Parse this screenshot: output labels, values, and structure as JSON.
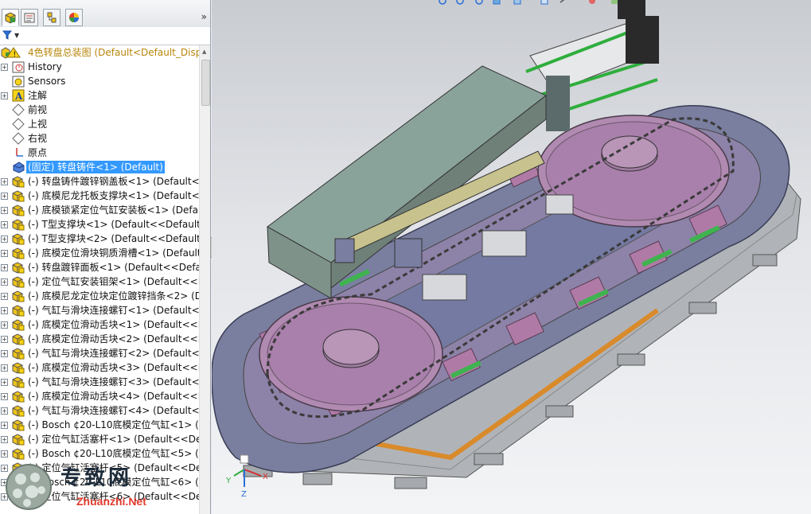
{
  "colors": {
    "selection": "#3399ff",
    "root_label": "#b8860b"
  },
  "panel": {
    "tabs": [
      "feature-manager",
      "property-manager",
      "configuration-manager",
      "appearance-manager"
    ],
    "expand_glyph": "»",
    "filter_icon": "funnel-icon"
  },
  "tree": {
    "root": "4色转盘总装图 (Default<Default_Disp",
    "items": [
      {
        "label": "History",
        "icon": "history-icon",
        "expand": true
      },
      {
        "label": "Sensors",
        "icon": "sensors-icon",
        "expand": false
      },
      {
        "label": "注解",
        "icon": "annotations-icon",
        "expand": true
      },
      {
        "label": "前视",
        "icon": "plane-icon",
        "expand": false
      },
      {
        "label": "上视",
        "icon": "plane-icon",
        "expand": false
      },
      {
        "label": "右视",
        "icon": "plane-icon",
        "expand": false
      },
      {
        "label": "原点",
        "icon": "origin-icon",
        "expand": false
      },
      {
        "label": "(固定) 转盘铸件<1> (Default)",
        "icon": "part-icon",
        "expand": false,
        "selected": true
      },
      {
        "label": "(-) 转盘铸件踱锌钢盖板<1> (Default<<",
        "icon": "assembly-icon",
        "expand": true
      },
      {
        "label": "(-) 底模尼龙托板支撑块<1> (Default<<",
        "icon": "assembly-icon",
        "expand": true
      },
      {
        "label": "(-) 底模锁紧定位气缸安装板<1> (Defau",
        "icon": "assembly-icon",
        "expand": true
      },
      {
        "label": "(-) T型支撑块<1> (Default<<Default>",
        "icon": "assembly-icon",
        "expand": true
      },
      {
        "label": "(-) T型支撑块<2> (Default<<Default>",
        "icon": "assembly-icon",
        "expand": true
      },
      {
        "label": "(-) 底模定位滑块铜质滑槽<1> (Default",
        "icon": "assembly-icon",
        "expand": true
      },
      {
        "label": "(-) 转盘踱锌面板<1> (Default<<Defau",
        "icon": "assembly-icon",
        "expand": true
      },
      {
        "label": "(-) 定位气缸安装钼架<1> (Default<<D",
        "icon": "assembly-icon",
        "expand": true
      },
      {
        "label": "(-) 底模尼龙定位块定位踱锌挡条<2> (D",
        "icon": "assembly-icon",
        "expand": true
      },
      {
        "label": "(-) 气缸与滑块连接螺钉<1> (Default<<",
        "icon": "assembly-icon",
        "expand": true
      },
      {
        "label": "(-) 底模定位滑动舌块<1> (Default<<D",
        "icon": "assembly-icon",
        "expand": true
      },
      {
        "label": "(-) 底模定位滑动舌块<2> (Default<<D",
        "icon": "assembly-icon",
        "expand": true
      },
      {
        "label": "(-) 气缸与滑块连接螺钉<2> (Default<<",
        "icon": "assembly-icon",
        "expand": true
      },
      {
        "label": "(-) 底模定位滑动舌块<3> (Default<<D",
        "icon": "assembly-icon",
        "expand": true
      },
      {
        "label": "(-) 气缸与滑块连接螺钉<3> (Default<<",
        "icon": "assembly-icon",
        "expand": true
      },
      {
        "label": "(-) 底模定位滑动舌块<4> (Default<<D",
        "icon": "assembly-icon",
        "expand": true
      },
      {
        "label": "(-) 气缸与滑块连接螺钉<4> (Default<<",
        "icon": "assembly-icon",
        "expand": true
      },
      {
        "label": "(-) Bosch  ¢20-L10底模定位气缸<1> (",
        "icon": "assembly-icon",
        "expand": true
      },
      {
        "label": "(-) 定位气缸活塞杆<1> (Default<<Def",
        "icon": "assembly-icon",
        "expand": true
      },
      {
        "label": "(-) Bosch  ¢20-L10底模定位气缸<5> (",
        "icon": "assembly-icon",
        "expand": true
      },
      {
        "label": "(-) 定位气缸活塞杆<5> (Default<<Def",
        "icon": "assembly-icon",
        "expand": true
      },
      {
        "label": "(-) Bosch  ¢20-L10底模定位气缸<6> (",
        "icon": "assembly-icon",
        "expand": true
      },
      {
        "label": "(-) 定位气缸活塞杆<6> (Default<<Def",
        "icon": "assembly-icon",
        "expand": true
      }
    ]
  },
  "watermark": {
    "cn": "专致网",
    "url": "Zhuanzhi.Net"
  },
  "triad": {
    "x": "X",
    "y": "Y",
    "z": "Z"
  }
}
